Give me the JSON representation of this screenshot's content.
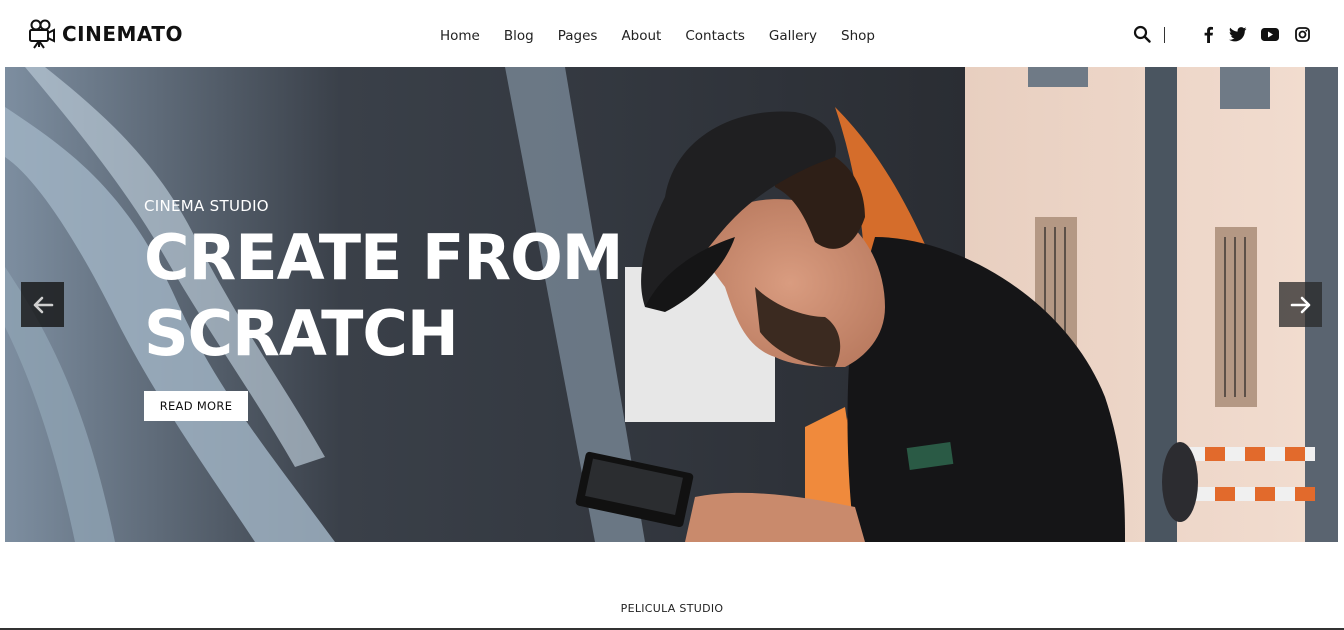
{
  "brand": {
    "name": "CINEMATO",
    "logo_icon": "movie-camera-icon"
  },
  "nav": {
    "items": [
      {
        "label": "Home"
      },
      {
        "label": "Blog"
      },
      {
        "label": "Pages"
      },
      {
        "label": "About"
      },
      {
        "label": "Contacts"
      },
      {
        "label": "Gallery"
      },
      {
        "label": "Shop"
      }
    ]
  },
  "tools": {
    "search_icon": "search-icon",
    "social": [
      "facebook-icon",
      "twitter-icon",
      "youtube-icon",
      "instagram-icon"
    ]
  },
  "hero": {
    "kicker": "CINEMA STUDIO",
    "title": "CREATE FROM SCRATCH",
    "button_label": "READ MORE",
    "prev_icon": "arrow-left-icon",
    "next_icon": "arrow-right-icon"
  },
  "section": {
    "subtitle": "PELICULA STUDIO"
  },
  "colors": {
    "text": "#1a1a1a",
    "hero_overlay_text": "#ffffff",
    "button_bg": "#ffffff",
    "arrow_bg": "#1e1e1e"
  }
}
